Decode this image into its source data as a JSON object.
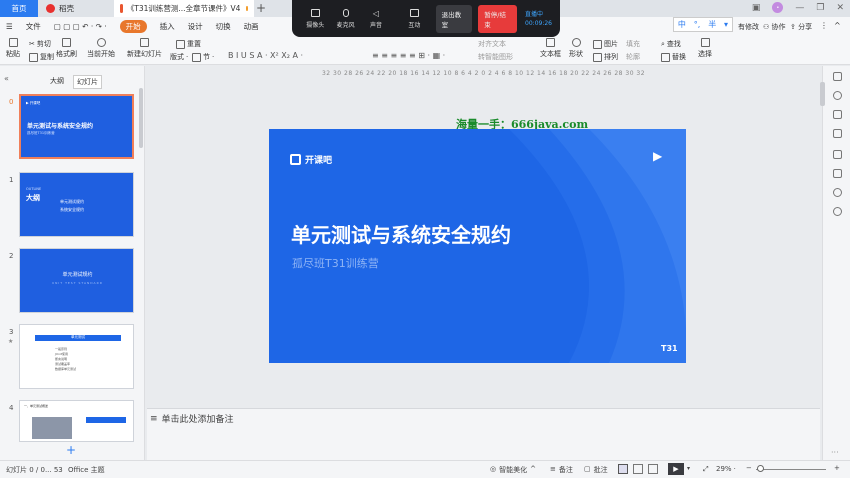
{
  "tabs": {
    "home": "首页",
    "daoke": "稻壳",
    "doc_title": "《T31训练营测...全章节课件》V4"
  },
  "menu": [
    "文件",
    "开始",
    "插入",
    "设计",
    "切换",
    "动画"
  ],
  "menu_right": [
    "有修改",
    "协作",
    "分享"
  ],
  "overlay": {
    "camera": "摄像头",
    "mic": "麦克风",
    "sound": "声音",
    "interact": "互动",
    "leave": "退出教室",
    "pause": "暂停/结束",
    "live_status": "直播中",
    "live_time": "00:09:26"
  },
  "ime": [
    "中",
    "°,",
    "半"
  ],
  "ribbon": {
    "paste": "粘贴",
    "cut": "剪切",
    "copy": "复制",
    "format_painter": "格式刷",
    "from_current": "当前开始",
    "new_slide": "新建幻灯片",
    "layout": "版式",
    "section": "节",
    "reset": "重置",
    "align_text": "对齐文本",
    "smart_graphic": "转智能图形",
    "textbox": "文本框",
    "shape": "形状",
    "arrange": "排列",
    "picture": "图片",
    "fill": "填充",
    "outline": "轮廓",
    "find": "查找",
    "replace": "替换",
    "select": "选择"
  },
  "left_panel": {
    "tab_outline": "大纲",
    "tab_slides": "幻灯片",
    "add": "+"
  },
  "thumbs": [
    {
      "num": "0",
      "title": "单元测试与系统安全规约",
      "sub": "孤尽班T31训练营"
    },
    {
      "num": "1",
      "title": "大纲",
      "sub": "OUTLINE",
      "items": [
        "单元测试规约",
        "系统安全规约"
      ]
    },
    {
      "num": "2",
      "title": "单元测试规约",
      "sub": "UNIT TEST STANDARD"
    },
    {
      "num": "3",
      "title": "单元测试",
      "items": [
        "一般原则",
        "JUnit使用",
        "断言说明",
        "测试覆盖率",
        "数据库单元测试"
      ]
    },
    {
      "num": "4",
      "title": "一、单元测试概述"
    }
  ],
  "ruler": "32 30 28 26 24 22 20 18 16 14 12 10 8 6 4 2 0 2 4 6 8 10 12 14 16 18 20 22 24 26 28 30 32",
  "watermark": "海量一手：666java.com",
  "slide": {
    "logo_text": "开课吧",
    "title": "单元测试与系统安全规约",
    "subtitle": "孤尽班T31训练营",
    "badge": "T31"
  },
  "notes_placeholder": "单击此处添加备注",
  "status": {
    "slide_info": "幻灯片 0 / 0... 53",
    "theme": "Office 主题",
    "smart_beautify": "智能美化",
    "notes": "备注",
    "comments": "批注",
    "zoom": "29%"
  },
  "colors": {
    "accent": "#2b7bf0",
    "slide_bg": "#1e66e6",
    "active_tab": "#e8772c",
    "watermark": "#1a8b2b"
  }
}
